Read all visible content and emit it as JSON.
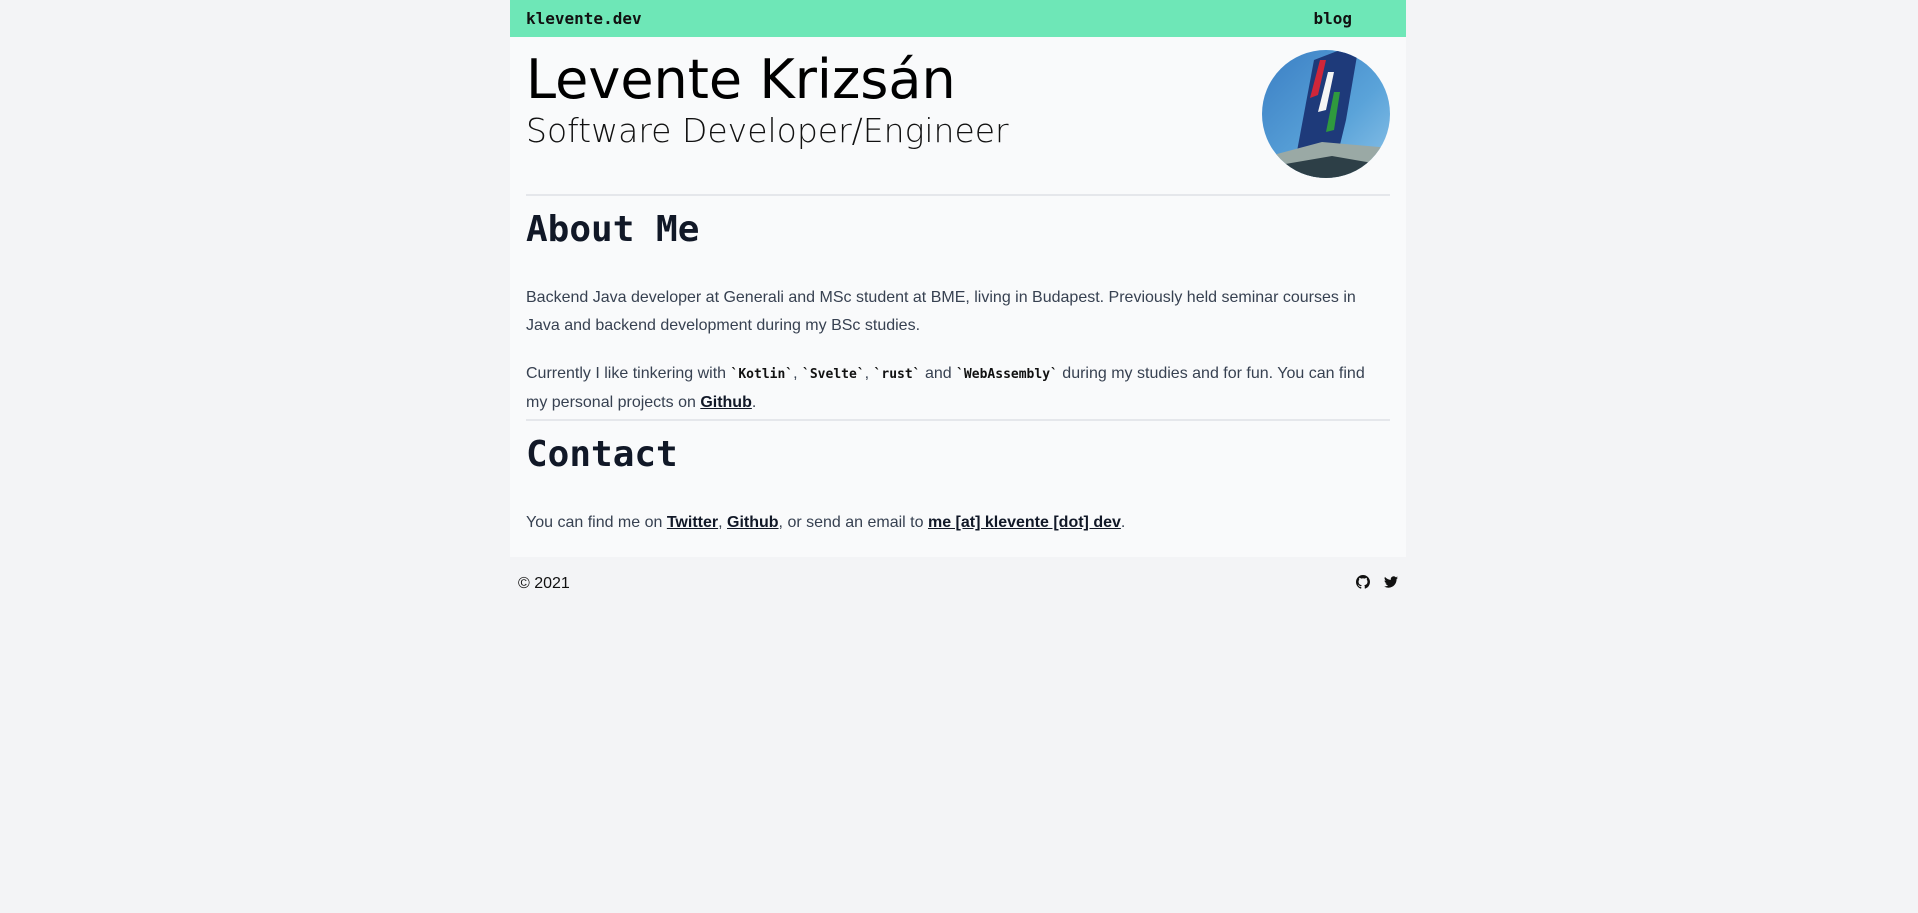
{
  "header": {
    "brand": "klevente.dev",
    "blog_label": "blog",
    "theme_toggle_icon": "moon-icon",
    "background_color": "#6ee7b7"
  },
  "profile": {
    "name": "Levente Krizsán",
    "role": "Software Developer/Engineer",
    "avatar_description": "aircraft tail with red white green stripes"
  },
  "about": {
    "heading": "About Me",
    "p1": "Backend Java developer at Generali and MSc student at BME, living in Budapest. Previously held seminar courses in Java and backend development during my BSc studies.",
    "p2_prefix": "Currently I like tinkering with ",
    "tech": [
      "`Kotlin`",
      "`Svelte`",
      "`rust`",
      "`WebAssembly`"
    ],
    "sep_comma": ", ",
    "sep_and": " and ",
    "p2_middle": " during my studies and for fun. You can find my personal projects on ",
    "github_link": "Github",
    "p2_suffix": "."
  },
  "contact": {
    "heading": "Contact",
    "prefix": "You can find me on ",
    "twitter_link": "Twitter",
    "sep": ", ",
    "github_link": "Github",
    "middle": ", or send an email to ",
    "email_link": "me [at] klevente [dot] dev",
    "suffix": "."
  },
  "footer": {
    "copyright": "© 2021",
    "icons": [
      "github-icon",
      "twitter-icon"
    ]
  }
}
